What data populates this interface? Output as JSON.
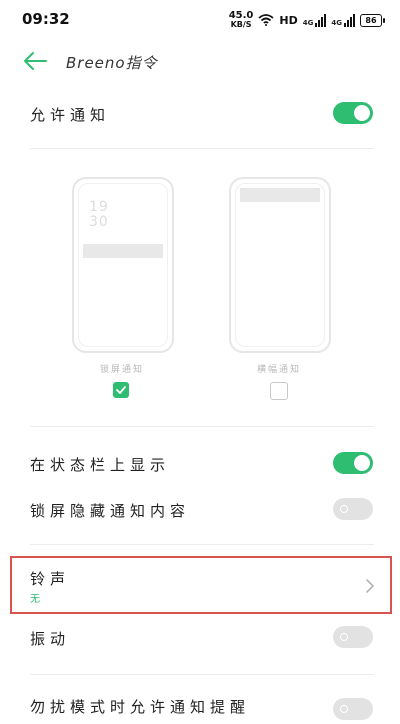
{
  "status_bar": {
    "time": "09:32",
    "net_speed": "45.0",
    "net_unit": "KB/S",
    "hd": "HD",
    "sig1": "4G",
    "sig2": "4G",
    "battery": "86"
  },
  "header": {
    "title": "Breeno指令"
  },
  "settings": {
    "allow_notifications": {
      "label": "允许通知",
      "enabled": true
    },
    "preview": {
      "lock_screen": {
        "clock_hour": "19",
        "clock_min": "30",
        "caption": "锁屏通知",
        "checked": true
      },
      "banner": {
        "caption": "横幅通知",
        "checked": false
      }
    },
    "show_on_status_bar": {
      "label": "在状态栏上显示",
      "enabled": true
    },
    "hide_lock_screen_content": {
      "label": "锁屏隐藏通知内容",
      "enabled": false
    },
    "ringtone": {
      "label": "铃声",
      "value": "无"
    },
    "vibrate": {
      "label": "振动",
      "enabled": false
    },
    "dnd_allow": {
      "label": "勿扰模式时允许通知提醒",
      "enabled": false
    }
  },
  "colors": {
    "accent": "#2fbd72",
    "highlight_border": "#d9534f"
  }
}
